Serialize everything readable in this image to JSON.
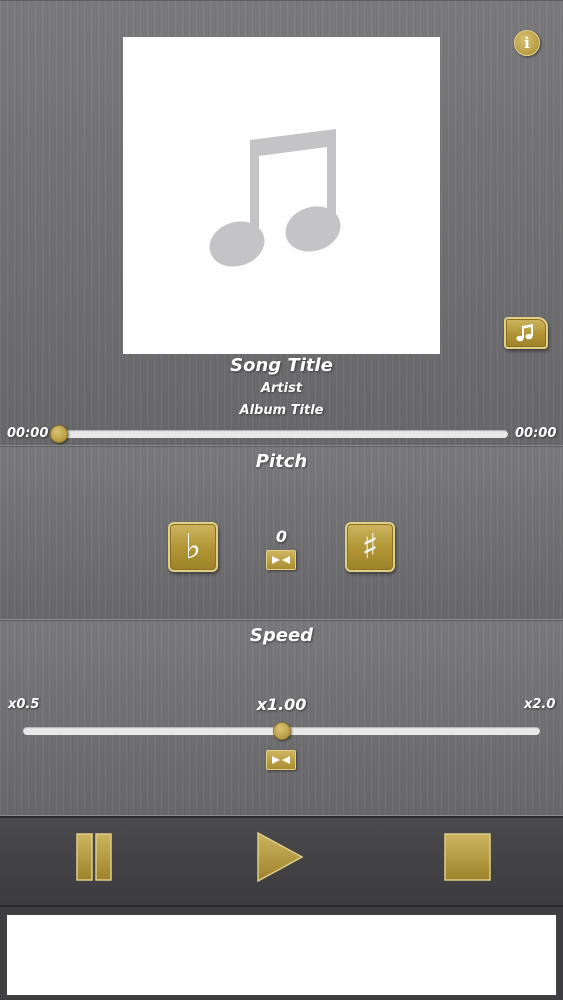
{
  "song": {
    "title": "Song Title",
    "artist": "Artist",
    "album": "Album Title"
  },
  "progress": {
    "elapsed": "00:00",
    "total": "00:00",
    "fraction": 0.0
  },
  "pitch": {
    "label": "Pitch",
    "value": "0",
    "flat_symbol": "♭",
    "sharp_symbol": "♯"
  },
  "speed": {
    "label": "Speed",
    "min_label": "x0.5",
    "max_label": "x2.0",
    "value_label": "x1.00",
    "fraction": 0.5
  },
  "icons": {
    "info": "info-icon",
    "folder": "music-folder-icon",
    "art": "music-note-icon",
    "pause": "pause-icon",
    "play": "play-icon",
    "stop": "stop-icon"
  },
  "colors": {
    "accent_gold": "#b09434",
    "panel": "#6f6f71",
    "controls_bar": "#3c3c3e"
  }
}
